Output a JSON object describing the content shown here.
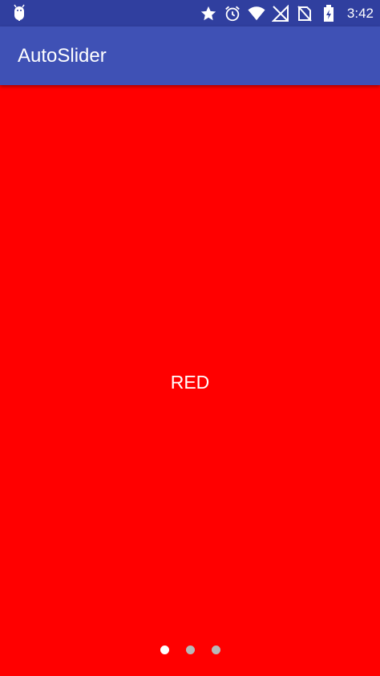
{
  "status_bar": {
    "time": "3:42",
    "icons": [
      "android-debug-icon",
      "star-icon",
      "alarm-icon",
      "wifi-icon",
      "no-signal-icon",
      "no-sim-icon",
      "battery-charging-icon"
    ],
    "background": "#303f9f"
  },
  "app_bar": {
    "title": "AutoSlider",
    "background": "#3f51b5"
  },
  "slider": {
    "current_slide": {
      "label": "RED",
      "background": "#ff0000"
    },
    "slide_count": 3,
    "active_index": 0,
    "indicator_active_color": "#ffffff",
    "indicator_inactive_color": "#b8b8b8"
  }
}
